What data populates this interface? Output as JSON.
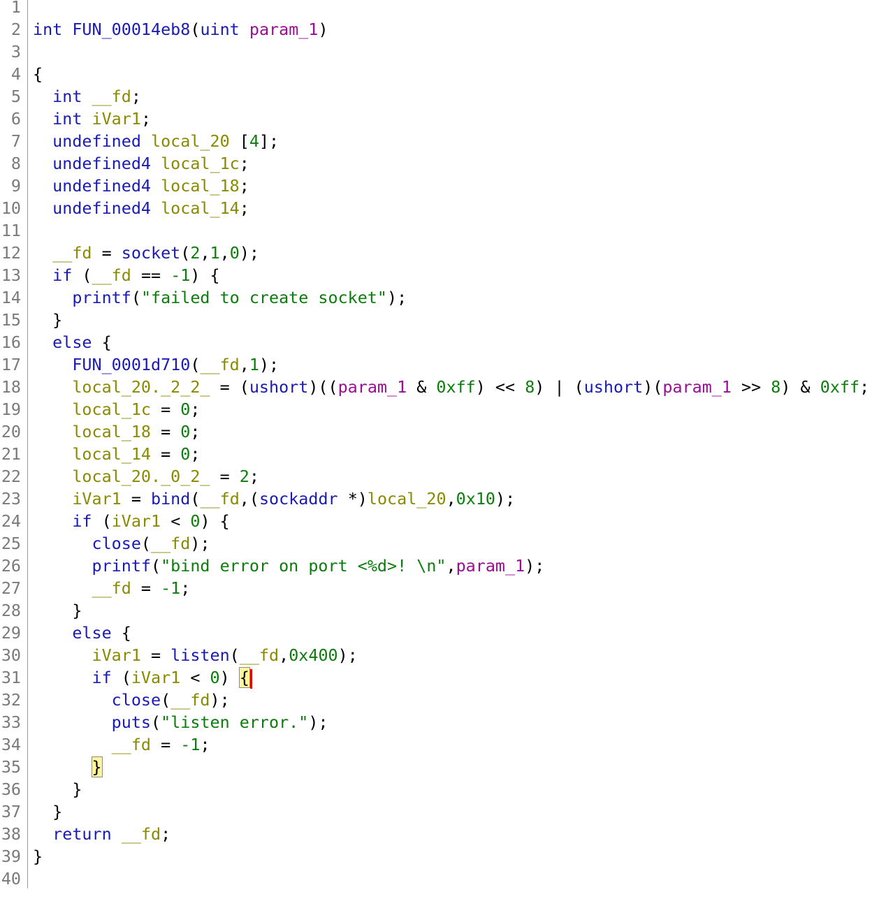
{
  "editor": {
    "lines": [
      {
        "n": "1",
        "tokens": []
      },
      {
        "n": "2",
        "tokens": [
          [
            "int",
            "kw"
          ],
          [
            " ",
            "punc"
          ],
          [
            "FUN_00014eb8",
            "fn"
          ],
          [
            "(",
            "punc"
          ],
          [
            "uint",
            "kw"
          ],
          [
            " ",
            "punc"
          ],
          [
            "param_1",
            "param"
          ],
          [
            ")",
            "punc"
          ]
        ]
      },
      {
        "n": "3",
        "tokens": []
      },
      {
        "n": "4",
        "tokens": [
          [
            "{",
            "punc"
          ]
        ]
      },
      {
        "n": "5",
        "tokens": [
          [
            "  ",
            "punc"
          ],
          [
            "int",
            "kw"
          ],
          [
            " ",
            "punc"
          ],
          [
            "__fd",
            "var"
          ],
          [
            ";",
            "punc"
          ]
        ]
      },
      {
        "n": "6",
        "tokens": [
          [
            "  ",
            "punc"
          ],
          [
            "int",
            "kw"
          ],
          [
            " ",
            "punc"
          ],
          [
            "iVar1",
            "var"
          ],
          [
            ";",
            "punc"
          ]
        ]
      },
      {
        "n": "7",
        "tokens": [
          [
            "  ",
            "punc"
          ],
          [
            "undefined",
            "kw"
          ],
          [
            " ",
            "punc"
          ],
          [
            "local_20",
            "var"
          ],
          [
            " [",
            "punc"
          ],
          [
            "4",
            "num"
          ],
          [
            "];",
            "punc"
          ]
        ]
      },
      {
        "n": "8",
        "tokens": [
          [
            "  ",
            "punc"
          ],
          [
            "undefined4",
            "kw"
          ],
          [
            " ",
            "punc"
          ],
          [
            "local_1c",
            "var"
          ],
          [
            ";",
            "punc"
          ]
        ]
      },
      {
        "n": "9",
        "tokens": [
          [
            "  ",
            "punc"
          ],
          [
            "undefined4",
            "kw"
          ],
          [
            " ",
            "punc"
          ],
          [
            "local_18",
            "var"
          ],
          [
            ";",
            "punc"
          ]
        ]
      },
      {
        "n": "10",
        "tokens": [
          [
            "  ",
            "punc"
          ],
          [
            "undefined4",
            "kw"
          ],
          [
            " ",
            "punc"
          ],
          [
            "local_14",
            "var"
          ],
          [
            ";",
            "punc"
          ]
        ]
      },
      {
        "n": "11",
        "tokens": []
      },
      {
        "n": "12",
        "tokens": [
          [
            "  ",
            "punc"
          ],
          [
            "__fd",
            "var"
          ],
          [
            " = ",
            "punc"
          ],
          [
            "socket",
            "fn"
          ],
          [
            "(",
            "punc"
          ],
          [
            "2",
            "num"
          ],
          [
            ",",
            "punc"
          ],
          [
            "1",
            "num"
          ],
          [
            ",",
            "punc"
          ],
          [
            "0",
            "num"
          ],
          [
            ");",
            "punc"
          ]
        ]
      },
      {
        "n": "13",
        "tokens": [
          [
            "  ",
            "punc"
          ],
          [
            "if",
            "kw"
          ],
          [
            " (",
            "punc"
          ],
          [
            "__fd",
            "var"
          ],
          [
            " == ",
            "punc"
          ],
          [
            "-1",
            "num"
          ],
          [
            ") {",
            "punc"
          ]
        ]
      },
      {
        "n": "14",
        "tokens": [
          [
            "    ",
            "punc"
          ],
          [
            "printf",
            "fn"
          ],
          [
            "(",
            "punc"
          ],
          [
            "\"failed to create socket\"",
            "str"
          ],
          [
            ");",
            "punc"
          ]
        ]
      },
      {
        "n": "15",
        "tokens": [
          [
            "  }",
            "punc"
          ]
        ]
      },
      {
        "n": "16",
        "tokens": [
          [
            "  ",
            "punc"
          ],
          [
            "else",
            "kw"
          ],
          [
            " {",
            "punc"
          ]
        ]
      },
      {
        "n": "17",
        "tokens": [
          [
            "    ",
            "punc"
          ],
          [
            "FUN_0001d710",
            "fn"
          ],
          [
            "(",
            "punc"
          ],
          [
            "__fd",
            "var"
          ],
          [
            ",",
            "punc"
          ],
          [
            "1",
            "num"
          ],
          [
            ");",
            "punc"
          ]
        ]
      },
      {
        "n": "18",
        "tokens": [
          [
            "    ",
            "punc"
          ],
          [
            "local_20._2_2_",
            "var"
          ],
          [
            " = (",
            "punc"
          ],
          [
            "ushort",
            "kw"
          ],
          [
            ")((",
            "punc"
          ],
          [
            "param_1",
            "param"
          ],
          [
            " & ",
            "punc"
          ],
          [
            "0xff",
            "num"
          ],
          [
            ") << ",
            "punc"
          ],
          [
            "8",
            "num"
          ],
          [
            ") | (",
            "punc"
          ],
          [
            "ushort",
            "kw"
          ],
          [
            ")(",
            "punc"
          ],
          [
            "param_1",
            "param"
          ],
          [
            " >> ",
            "punc"
          ],
          [
            "8",
            "num"
          ],
          [
            ") & ",
            "punc"
          ],
          [
            "0xff",
            "num"
          ],
          [
            ";",
            "punc"
          ]
        ]
      },
      {
        "n": "19",
        "tokens": [
          [
            "    ",
            "punc"
          ],
          [
            "local_1c",
            "var"
          ],
          [
            " = ",
            "punc"
          ],
          [
            "0",
            "num"
          ],
          [
            ";",
            "punc"
          ]
        ]
      },
      {
        "n": "20",
        "tokens": [
          [
            "    ",
            "punc"
          ],
          [
            "local_18",
            "var"
          ],
          [
            " = ",
            "punc"
          ],
          [
            "0",
            "num"
          ],
          [
            ";",
            "punc"
          ]
        ]
      },
      {
        "n": "21",
        "tokens": [
          [
            "    ",
            "punc"
          ],
          [
            "local_14",
            "var"
          ],
          [
            " = ",
            "punc"
          ],
          [
            "0",
            "num"
          ],
          [
            ";",
            "punc"
          ]
        ]
      },
      {
        "n": "22",
        "tokens": [
          [
            "    ",
            "punc"
          ],
          [
            "local_20._0_2_",
            "var"
          ],
          [
            " = ",
            "punc"
          ],
          [
            "2",
            "num"
          ],
          [
            ";",
            "punc"
          ]
        ]
      },
      {
        "n": "23",
        "tokens": [
          [
            "    ",
            "punc"
          ],
          [
            "iVar1",
            "var"
          ],
          [
            " = ",
            "punc"
          ],
          [
            "bind",
            "fn"
          ],
          [
            "(",
            "punc"
          ],
          [
            "__fd",
            "var"
          ],
          [
            ",(",
            "punc"
          ],
          [
            "sockaddr",
            "kw"
          ],
          [
            " *)",
            "punc"
          ],
          [
            "local_20",
            "var"
          ],
          [
            ",",
            "punc"
          ],
          [
            "0x10",
            "num"
          ],
          [
            ");",
            "punc"
          ]
        ]
      },
      {
        "n": "24",
        "tokens": [
          [
            "    ",
            "punc"
          ],
          [
            "if",
            "kw"
          ],
          [
            " (",
            "punc"
          ],
          [
            "iVar1",
            "var"
          ],
          [
            " < ",
            "punc"
          ],
          [
            "0",
            "num"
          ],
          [
            ") {",
            "punc"
          ]
        ]
      },
      {
        "n": "25",
        "tokens": [
          [
            "      ",
            "punc"
          ],
          [
            "close",
            "fn"
          ],
          [
            "(",
            "punc"
          ],
          [
            "__fd",
            "var"
          ],
          [
            ");",
            "punc"
          ]
        ]
      },
      {
        "n": "26",
        "tokens": [
          [
            "      ",
            "punc"
          ],
          [
            "printf",
            "fn"
          ],
          [
            "(",
            "punc"
          ],
          [
            "\"bind error on port <%d>! \\n\"",
            "str"
          ],
          [
            ",",
            "punc"
          ],
          [
            "param_1",
            "param"
          ],
          [
            ");",
            "punc"
          ]
        ]
      },
      {
        "n": "27",
        "tokens": [
          [
            "      ",
            "punc"
          ],
          [
            "__fd",
            "var"
          ],
          [
            " = ",
            "punc"
          ],
          [
            "-1",
            "num"
          ],
          [
            ";",
            "punc"
          ]
        ]
      },
      {
        "n": "28",
        "tokens": [
          [
            "    }",
            "punc"
          ]
        ]
      },
      {
        "n": "29",
        "tokens": [
          [
            "    ",
            "punc"
          ],
          [
            "else",
            "kw"
          ],
          [
            " {",
            "punc"
          ]
        ]
      },
      {
        "n": "30",
        "tokens": [
          [
            "      ",
            "punc"
          ],
          [
            "iVar1",
            "var"
          ],
          [
            " = ",
            "punc"
          ],
          [
            "listen",
            "fn"
          ],
          [
            "(",
            "punc"
          ],
          [
            "__fd",
            "var"
          ],
          [
            ",",
            "punc"
          ],
          [
            "0x400",
            "num"
          ],
          [
            ");",
            "punc"
          ]
        ]
      },
      {
        "n": "31",
        "tokens": [
          [
            "      ",
            "punc"
          ],
          [
            "if",
            "kw"
          ],
          [
            " (",
            "punc"
          ],
          [
            "iVar1",
            "var"
          ],
          [
            " < ",
            "punc"
          ],
          [
            "0",
            "num"
          ],
          [
            ") ",
            "punc"
          ],
          [
            "{",
            "brace-hl"
          ]
        ],
        "caret": true
      },
      {
        "n": "32",
        "tokens": [
          [
            "        ",
            "punc"
          ],
          [
            "close",
            "fn"
          ],
          [
            "(",
            "punc"
          ],
          [
            "__fd",
            "var"
          ],
          [
            ");",
            "punc"
          ]
        ]
      },
      {
        "n": "33",
        "tokens": [
          [
            "        ",
            "punc"
          ],
          [
            "puts",
            "fn"
          ],
          [
            "(",
            "punc"
          ],
          [
            "\"listen error.\"",
            "str"
          ],
          [
            ");",
            "punc"
          ]
        ]
      },
      {
        "n": "34",
        "tokens": [
          [
            "        ",
            "punc"
          ],
          [
            "__fd",
            "var"
          ],
          [
            " = ",
            "punc"
          ],
          [
            "-1",
            "num"
          ],
          [
            ";",
            "punc"
          ]
        ]
      },
      {
        "n": "35",
        "tokens": [
          [
            "      ",
            "punc"
          ],
          [
            "}",
            "brace-hl"
          ]
        ]
      },
      {
        "n": "36",
        "tokens": [
          [
            "    }",
            "punc"
          ]
        ]
      },
      {
        "n": "37",
        "tokens": [
          [
            "  }",
            "punc"
          ]
        ]
      },
      {
        "n": "38",
        "tokens": [
          [
            "  ",
            "punc"
          ],
          [
            "return",
            "kw"
          ],
          [
            " ",
            "punc"
          ],
          [
            "__fd",
            "var"
          ],
          [
            ";",
            "punc"
          ]
        ]
      },
      {
        "n": "39",
        "tokens": [
          [
            "}",
            "punc"
          ]
        ]
      },
      {
        "n": "40",
        "tokens": []
      }
    ]
  }
}
